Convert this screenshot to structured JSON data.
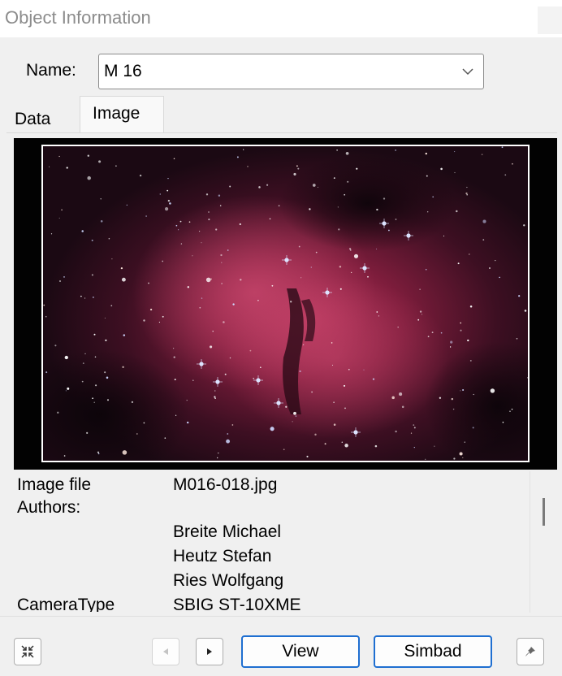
{
  "window": {
    "title": "Object Information"
  },
  "name_field": {
    "label": "Name:",
    "value": "M 16"
  },
  "tabs": [
    {
      "label": "Data",
      "selected": false
    },
    {
      "label": "Image",
      "selected": true
    }
  ],
  "image_info": {
    "image_file_label": "Image file",
    "image_file_value": "M016-018.jpg",
    "authors_label": "Authors:",
    "authors": [
      "Breite Michael",
      "Heutz Stefan",
      "Ries Wolfgang"
    ],
    "camera_label": "CameraType",
    "camera_value": "SBIG ST-10XME"
  },
  "buttons": {
    "collapse_icon": "collapse-arrows-icon",
    "prev_icon": "triangle-left-icon",
    "next_icon": "triangle-right-icon",
    "view_label": "View",
    "simbad_label": "Simbad",
    "pin_icon": "pushpin-icon"
  },
  "colors": {
    "accent_border": "#1f6fd1",
    "nebula": "#8a1f3c",
    "image_border": "#ffffff"
  }
}
